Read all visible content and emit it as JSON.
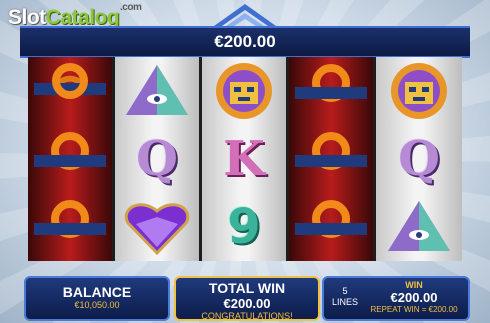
{
  "watermark": {
    "brand_part1": "Slot",
    "brand_part2": "Catalog",
    "tld": ".com"
  },
  "header": {
    "bet_amount": "€200.00"
  },
  "reels": [
    [
      "horseshoe",
      "horseshoe",
      "horseshoe"
    ],
    [
      "pyramid",
      "Q",
      "heart-gem"
    ],
    [
      "mask",
      "K",
      "9"
    ],
    [
      "horseshoe",
      "horseshoe",
      "horseshoe"
    ],
    [
      "mask",
      "Q",
      "pyramid"
    ]
  ],
  "balance": {
    "label": "BALANCE",
    "value": "€10,050.00"
  },
  "total_win": {
    "label": "TOTAL WIN",
    "value": "€200.00",
    "message": "CONGRATULATIONS!"
  },
  "win": {
    "lines_count": "5",
    "lines_label": "LINES",
    "label": "WIN",
    "value": "€200.00",
    "repeat": "REPEAT WIN = €200.00"
  },
  "colors": {
    "reel_red": "#b81c1c",
    "panel_blue": "#1f3a7d",
    "accent_gold": "#f0c040",
    "banner_border": "#3f6fd0"
  }
}
